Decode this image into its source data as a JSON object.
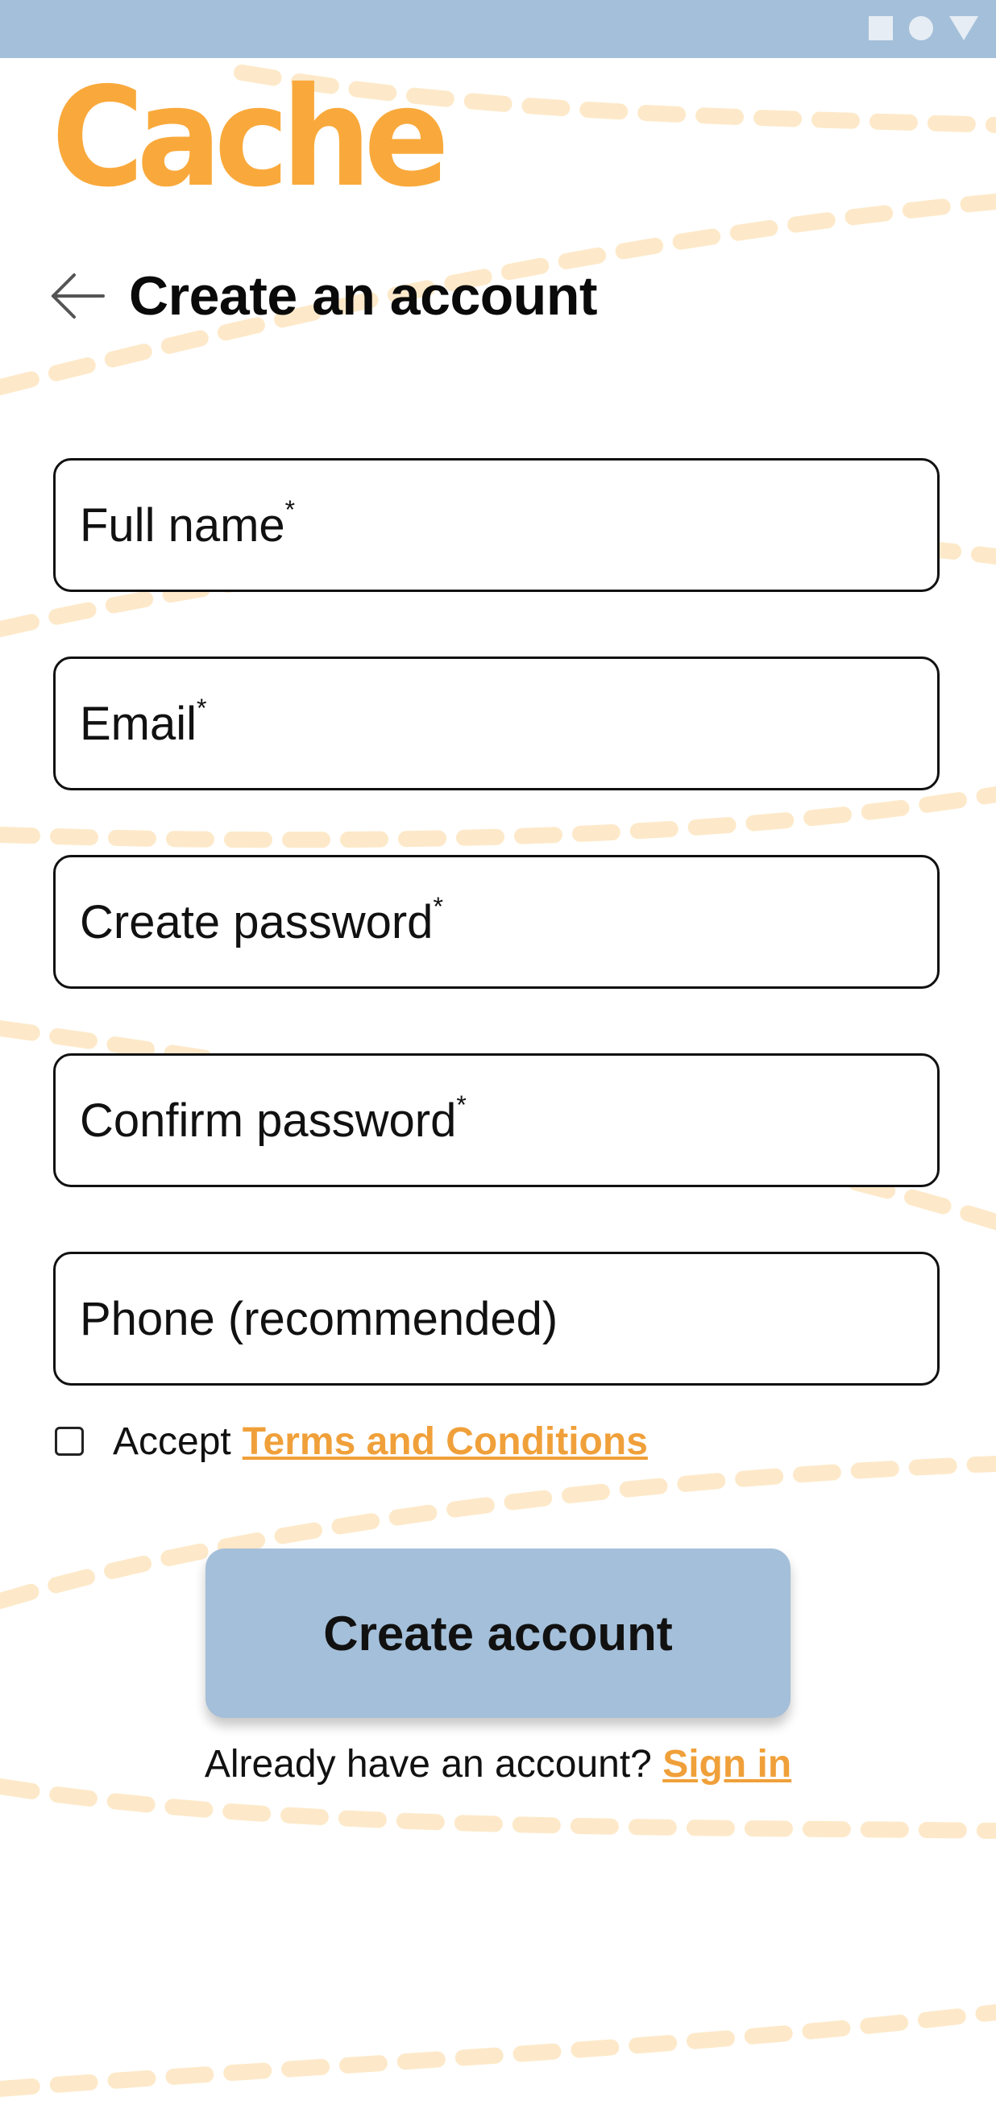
{
  "status_bar": {
    "icons": [
      "square-icon",
      "circle-icon",
      "triangle-icon"
    ]
  },
  "app": {
    "logo_text": "Cache"
  },
  "header": {
    "back_icon": "arrow-left-icon",
    "title": "Create an account"
  },
  "form": {
    "full_name": {
      "label": "Full name",
      "required_mark": "*"
    },
    "email": {
      "label": "Email",
      "required_mark": "*"
    },
    "create_password": {
      "label": "Create password",
      "required_mark": "*"
    },
    "confirm_password": {
      "label": "Confirm password",
      "required_mark": "*"
    },
    "phone": {
      "label": "Phone (recommended)"
    }
  },
  "terms": {
    "accept_label": "Accept",
    "link_label": "Terms and Conditions",
    "checked": false
  },
  "actions": {
    "create_account_label": "Create account"
  },
  "signin": {
    "prompt": "Already have an account?",
    "link_label": "Sign in"
  },
  "colors": {
    "accent_orange": "#f9a93b",
    "link_orange": "#f0a03a",
    "primary_blue": "#a4bfd9",
    "background_dash": "#fde9c9"
  }
}
